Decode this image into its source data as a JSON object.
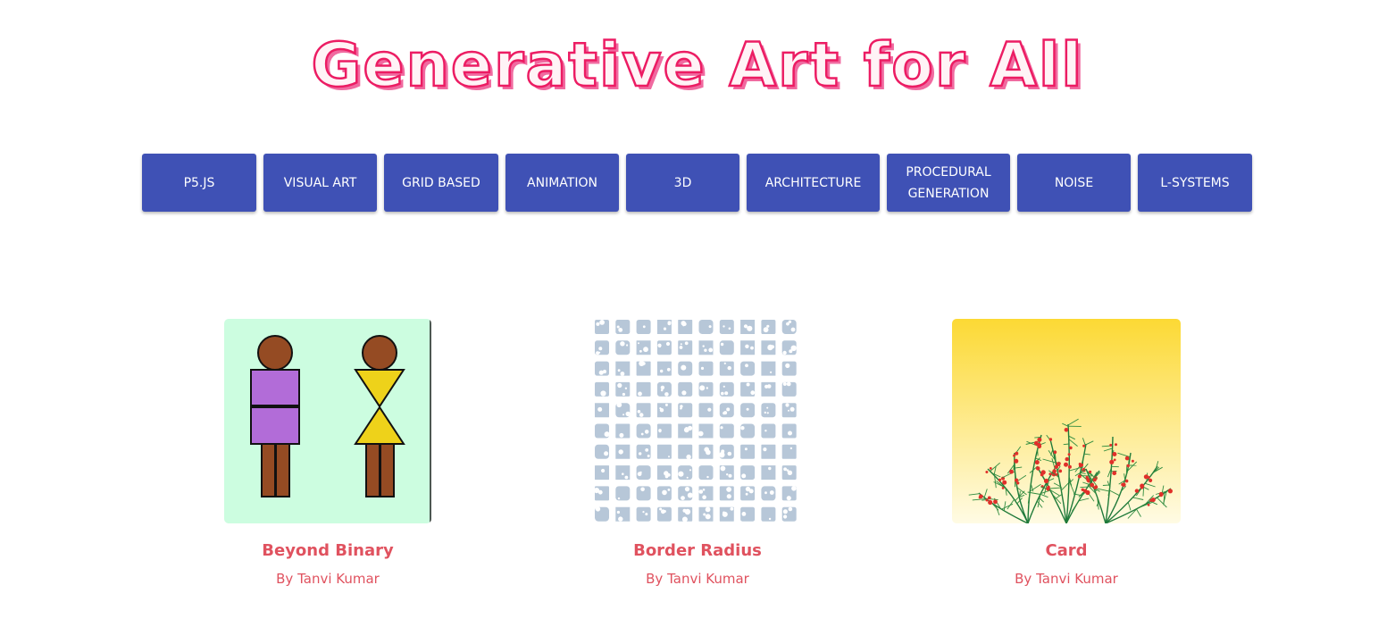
{
  "header": {
    "title": "Generative Art for All",
    "title_color": "#ec1c63"
  },
  "tags": [
    {
      "label": "P5.JS"
    },
    {
      "label": "VISUAL ART"
    },
    {
      "label": "GRID BASED"
    },
    {
      "label": "ANIMATION"
    },
    {
      "label": "3D"
    },
    {
      "label": "ARCHITECTURE"
    },
    {
      "label_line1": "PROCEDURAL",
      "label_line2": "GENERATION"
    },
    {
      "label": "NOISE"
    },
    {
      "label": "L-SYSTEMS"
    }
  ],
  "tag_color": "#3f51b5",
  "projects": [
    {
      "title": "Beyond Binary",
      "author": "By Tanvi Kumar",
      "thumbnail": "figures-artwork"
    },
    {
      "title": "Border Radius",
      "author": "By Tanvi Kumar",
      "thumbnail": "grid-artwork"
    },
    {
      "title": "Card",
      "author": "By Tanvi Kumar",
      "thumbnail": "plant-artwork"
    }
  ],
  "accent_color": "#e0525f"
}
